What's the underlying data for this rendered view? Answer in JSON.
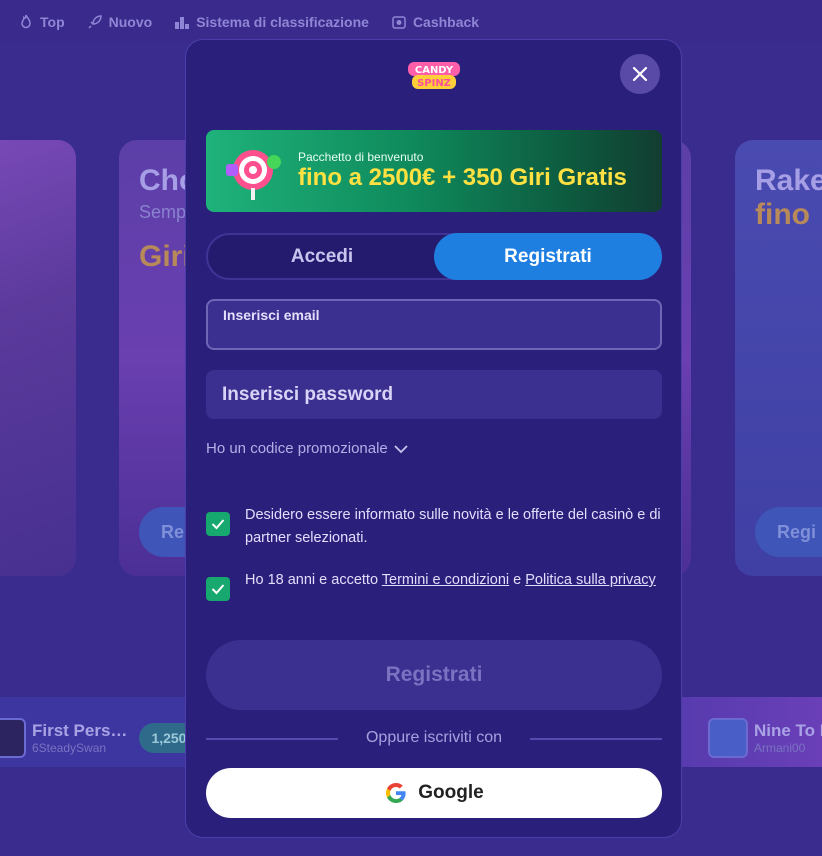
{
  "nav": {
    "items": [
      {
        "label": "Top",
        "icon": "flame-icon"
      },
      {
        "label": "Nuovo",
        "icon": "rocket-icon"
      },
      {
        "label": "Sistema di classificazione",
        "icon": "podium-icon"
      },
      {
        "label": "Cashback",
        "icon": "cashback-icon"
      }
    ]
  },
  "banners": {
    "center": {
      "title": "Cho",
      "subtitle": "Semp",
      "highlight": "Giri",
      "button": "Re"
    },
    "right": {
      "title": "Rake",
      "highlight": "fino",
      "button": "Regi"
    }
  },
  "winners": [
    {
      "game": "First Pers…",
      "user": "6SteadySwan",
      "amount": "1,250"
    },
    {
      "game": "Nine To I",
      "user": "Armani00"
    }
  ],
  "modal": {
    "logo_text": "CANDY SPINZ",
    "close_icon": "close-icon",
    "promo": {
      "small": "Pacchetto di benvenuto",
      "big": "fino a 2500€ + 350 Giri Gratis"
    },
    "tabs": {
      "login": "Accedi",
      "register": "Registrati",
      "active": "register"
    },
    "email": {
      "label": "Inserisci email",
      "value": ""
    },
    "password": {
      "placeholder": "Inserisci password",
      "value": ""
    },
    "promo_code_label": "Ho un codice promozionale",
    "consent_news": {
      "checked": true,
      "text": "Desidero essere informato sulle novità e le offerte del casinò e di partner selezionati."
    },
    "consent_age": {
      "checked": true,
      "prefix": "Ho 18 anni e accetto ",
      "terms_link": "Termini e condizioni",
      "middle": " e ",
      "privacy_link": "Politica sulla privacy"
    },
    "submit_label": "Registrati",
    "divider_text": "Oppure iscriviti con",
    "google_label": "Google"
  },
  "colors": {
    "background": "#3a2a8c",
    "modal": "#2b1f7c",
    "accent_blue": "#1f7fe0",
    "check_green": "#16a86e",
    "promo_yellow": "#ffe142"
  }
}
